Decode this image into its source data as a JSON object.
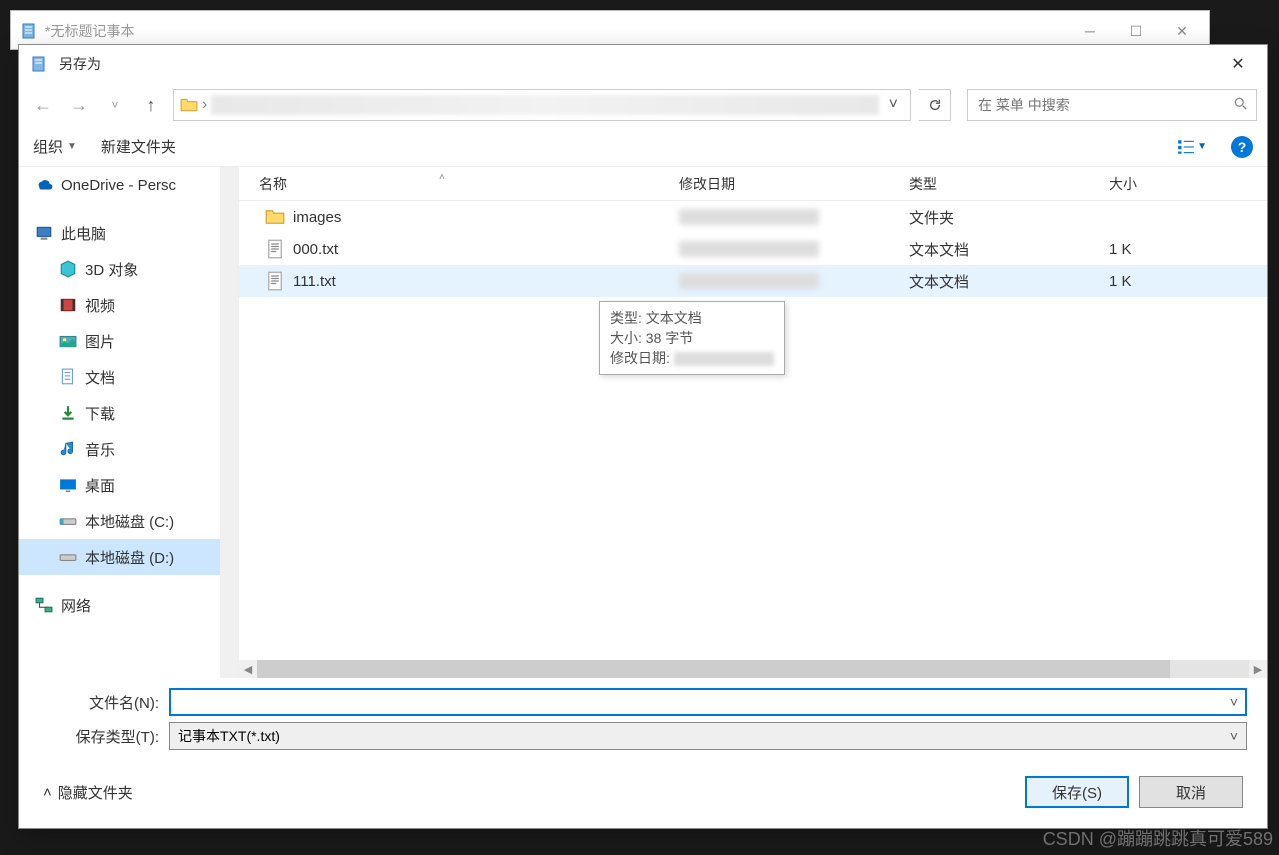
{
  "parent_window": {
    "title": "*无标题记事本"
  },
  "dialog": {
    "title": "另存为"
  },
  "search": {
    "placeholder": "在 菜单 中搜索"
  },
  "toolbar": {
    "organize": "组织",
    "new_folder": "新建文件夹"
  },
  "columns": {
    "name": "名称",
    "date": "修改日期",
    "type": "类型",
    "size": "大小"
  },
  "nav_tree": {
    "onedrive": "OneDrive - Persc",
    "this_pc": "此电脑",
    "objects_3d": "3D 对象",
    "videos": "视频",
    "pictures": "图片",
    "documents": "文档",
    "downloads": "下载",
    "music": "音乐",
    "desktop": "桌面",
    "disk_c": "本地磁盘 (C:)",
    "disk_d": "本地磁盘 (D:)",
    "network": "网络"
  },
  "files": [
    {
      "name": "images",
      "type": "文件夹",
      "size": "",
      "kind": "folder"
    },
    {
      "name": "000.txt",
      "type": "文本文档",
      "size": "1 K",
      "kind": "text"
    },
    {
      "name": "111.txt",
      "type": "文本文档",
      "size": "1 K",
      "kind": "text"
    }
  ],
  "tooltip": {
    "type_label": "类型:",
    "type_value": "文本文档",
    "size_label": "大小:",
    "size_value": "38 字节",
    "date_label": "修改日期:"
  },
  "form": {
    "filename_label": "文件名(N):",
    "filename_value": "",
    "filetype_label": "保存类型(T):",
    "filetype_value": "记事本TXT(*.txt)"
  },
  "footer": {
    "hide_folders": "隐藏文件夹",
    "save": "保存(S)",
    "cancel": "取消"
  },
  "watermark": "CSDN @蹦蹦跳跳真可爱589"
}
